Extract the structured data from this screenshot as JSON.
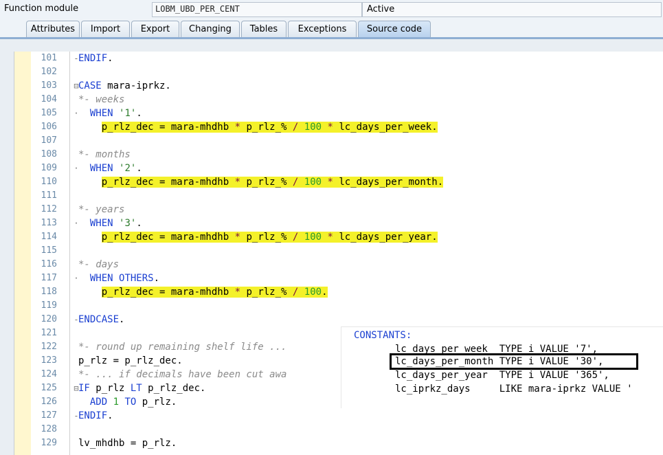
{
  "header": {
    "label": "Function module",
    "name": "LOBM_UBD_PER_CENT",
    "status": "Active"
  },
  "tabs": [
    "Attributes",
    "Import",
    "Export",
    "Changing",
    "Tables",
    "Exceptions",
    "Source code"
  ],
  "active_tab": "Source code",
  "lines": [
    {
      "n": "101",
      "mark": "-",
      "code": "ENDIF."
    },
    {
      "n": "102",
      "mark": "",
      "code": ""
    },
    {
      "n": "103",
      "mark": "⊟",
      "code": "CASE mara-iprkz."
    },
    {
      "n": "104",
      "mark": "",
      "code": "*- weeks"
    },
    {
      "n": "105",
      "mark": "·",
      "code": "  WHEN '1'."
    },
    {
      "n": "106",
      "mark": "",
      "code": "    p_rlz_dec = mara-mhdhb * p_rlz_% / 100 * lc_days_per_week."
    },
    {
      "n": "107",
      "mark": "",
      "code": ""
    },
    {
      "n": "108",
      "mark": "",
      "code": "*- months"
    },
    {
      "n": "109",
      "mark": "·",
      "code": "  WHEN '2'."
    },
    {
      "n": "110",
      "mark": "",
      "code": "    p_rlz_dec = mara-mhdhb * p_rlz_% / 100 * lc_days_per_month."
    },
    {
      "n": "111",
      "mark": "",
      "code": ""
    },
    {
      "n": "112",
      "mark": "",
      "code": "*- years"
    },
    {
      "n": "113",
      "mark": "·",
      "code": "  WHEN '3'."
    },
    {
      "n": "114",
      "mark": "",
      "code": "    p_rlz_dec = mara-mhdhb * p_rlz_% / 100 * lc_days_per_year."
    },
    {
      "n": "115",
      "mark": "",
      "code": ""
    },
    {
      "n": "116",
      "mark": "",
      "code": "*- days"
    },
    {
      "n": "117",
      "mark": "·",
      "code": "  WHEN OTHERS."
    },
    {
      "n": "118",
      "mark": "",
      "code": "    p_rlz_dec = mara-mhdhb * p_rlz_% / 100."
    },
    {
      "n": "119",
      "mark": "",
      "code": ""
    },
    {
      "n": "120",
      "mark": "-",
      "code": "ENDCASE."
    },
    {
      "n": "121",
      "mark": "",
      "code": ""
    },
    {
      "n": "122",
      "mark": "",
      "code": "*- round up remaining shelf life ..."
    },
    {
      "n": "123",
      "mark": "",
      "code": "p_rlz = p_rlz_dec."
    },
    {
      "n": "124",
      "mark": "",
      "code": "*- ... if decimals have been cut awa"
    },
    {
      "n": "125",
      "mark": "⊟",
      "code": "IF p_rlz LT p_rlz_dec."
    },
    {
      "n": "126",
      "mark": "",
      "code": "  ADD 1 TO p_rlz."
    },
    {
      "n": "127",
      "mark": "-",
      "code": "ENDIF."
    },
    {
      "n": "128",
      "mark": "",
      "code": ""
    },
    {
      "n": "129",
      "mark": "",
      "code": "lv_mhdhb = p_rlz."
    }
  ],
  "popup": {
    "title": "CONSTANTS:",
    "rows": [
      "lc_days_per_week  TYPE i VALUE '7',",
      "lc_days_per_month TYPE i VALUE '30',",
      "lc_days_per_year  TYPE i VALUE '365',",
      "lc_iprkz_days     LIKE mara-iprkz VALUE '"
    ]
  }
}
